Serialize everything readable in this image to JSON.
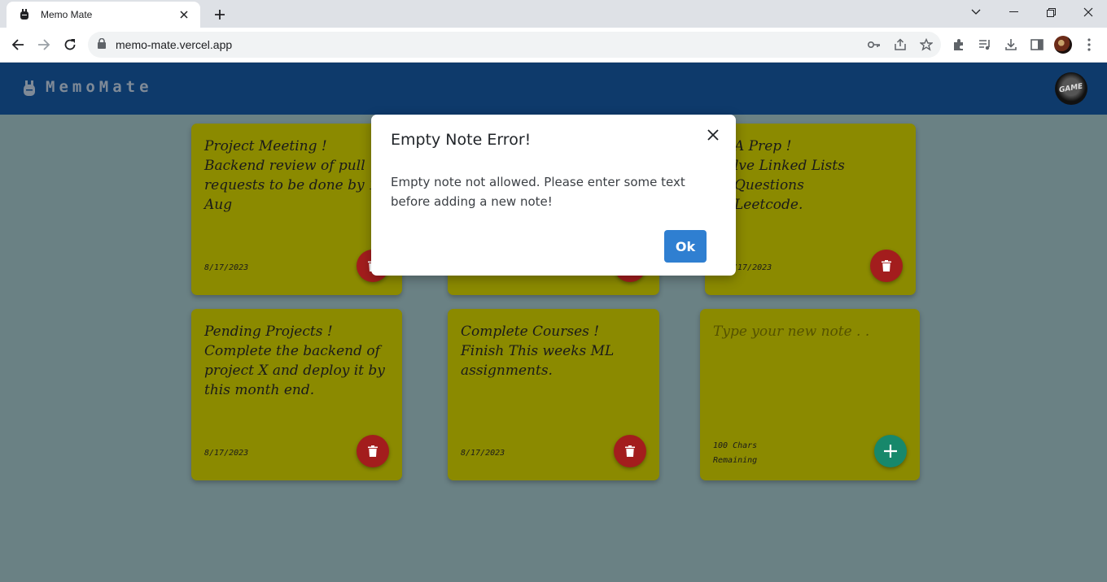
{
  "browser": {
    "tab_title": "Memo Mate",
    "url": "memo-mate.vercel.app"
  },
  "app": {
    "brand": "MemoMate",
    "notes": [
      {
        "text": "Project Meeting !\nBackend review of pull requests to be done by 18 Aug",
        "date": "8/17/2023"
      },
      {
        "text": "",
        "date": ""
      },
      {
        "text": "A Prep !\nlve Linked Lists Questions\nLeetcode.",
        "date": "/17/2023"
      },
      {
        "text": "Pending Projects !\nComplete the backend of project X and deploy it by this month end.",
        "date": "8/17/2023"
      },
      {
        "text": "Complete Courses !\nFinish This weeks ML assignments.",
        "date": "8/17/2023"
      }
    ],
    "new_note": {
      "placeholder": "Type your new note . .",
      "chars_remaining": "100 Chars\nRemaining"
    }
  },
  "modal": {
    "title": "Empty Note Error!",
    "body": "Empty note not allowed. Please enter some text before adding a new note!",
    "ok_label": "Ok"
  },
  "colors": {
    "navbar": "#0e3a6b",
    "note": "#8b8a00",
    "delete": "#a31d1d",
    "add": "#17886b",
    "ok": "#2f7fd1"
  }
}
